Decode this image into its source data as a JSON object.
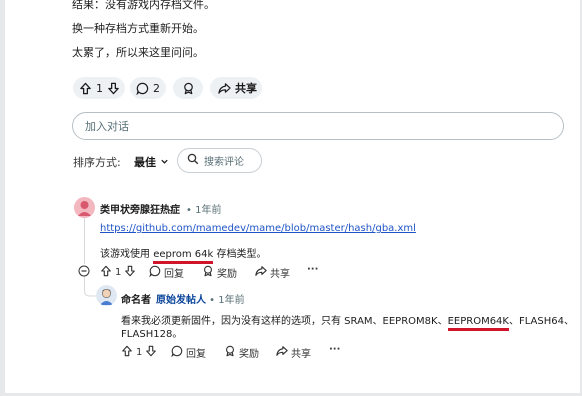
{
  "post": {
    "lines": [
      "结果：没有游戏内存档文件。",
      "换一种存档方式重新开始。",
      "太累了，所以来这里问问。"
    ]
  },
  "post_actions": {
    "vote_count": "1",
    "comment_count": "2",
    "share_label": "共享"
  },
  "comment_input": {
    "placeholder": "加入对话"
  },
  "sort": {
    "label": "排序方式:",
    "value": "最佳",
    "search_placeholder": "搜索评论"
  },
  "comments": [
    {
      "username": "类甲状旁腺狂热症",
      "time": "1年前",
      "link": "https://github.com/mamedev/mame/blob/master/hash/gba.xml",
      "text_before": "该游戏使用 ",
      "text_highlight": "eeprom 64k",
      "text_after": " 存档类型。",
      "votes": "1",
      "reply_label": "回复",
      "award_label": "奖励",
      "share_label": "共享",
      "more_label": "···"
    },
    {
      "username": "命名者",
      "op_tag": "原始发帖人",
      "time": "1年前",
      "text_line1_before": "看来我必须更新固件，因为没有这样的选项，只有 SRAM、EEPROM8K、",
      "text_line1_highlight": "EEPROM64K",
      "text_line1_after": "、FLASH64、",
      "text_line2": "FLASH128。",
      "votes": "1",
      "reply_label": "回复",
      "award_label": "奖励",
      "share_label": "共享",
      "more_label": "···"
    }
  ],
  "colors": {
    "link": "#1f54c6",
    "highlight_underline": "#d0142a",
    "op_tag": "#0a449b"
  }
}
